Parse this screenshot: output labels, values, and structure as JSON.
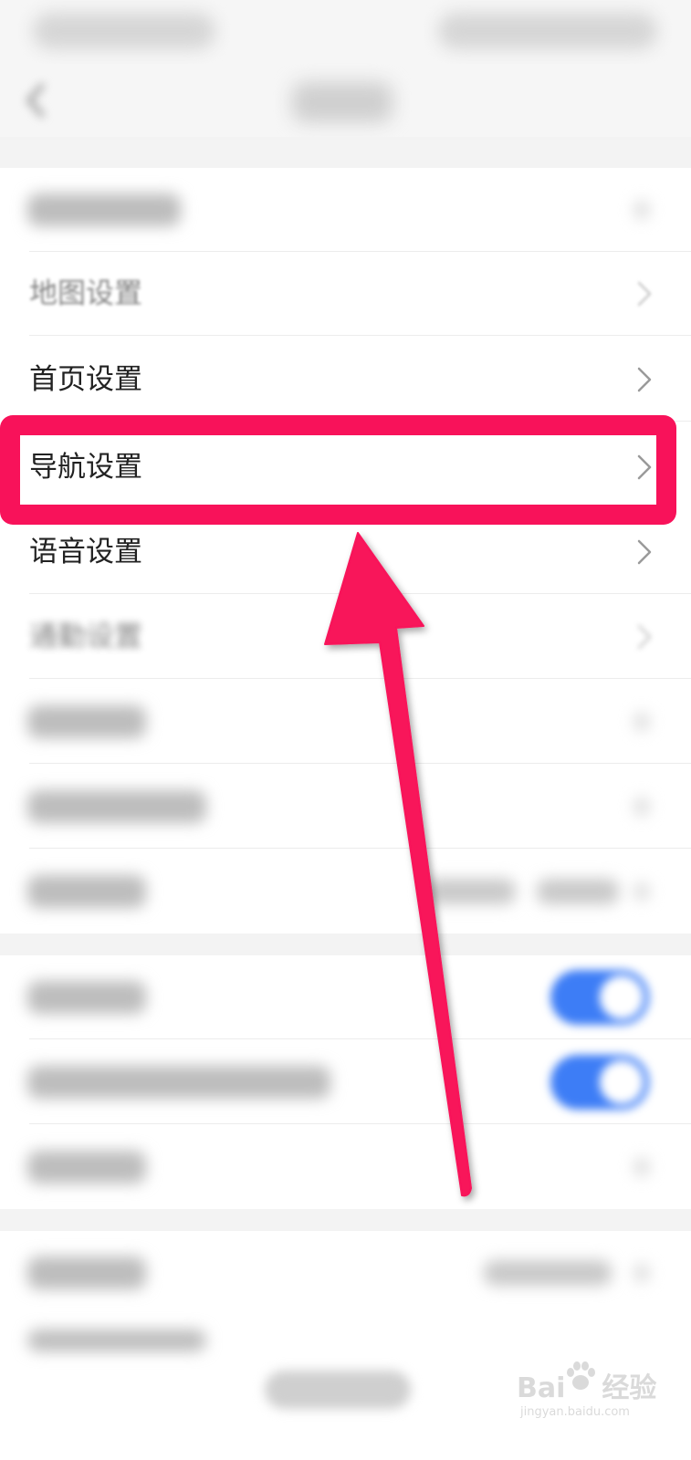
{
  "settings": {
    "rows": [
      {
        "label": "地图设置"
      },
      {
        "label": "首页设置"
      },
      {
        "label": "导航设置"
      },
      {
        "label": "语音设置"
      },
      {
        "label": "通勤设置"
      }
    ]
  },
  "watermark": {
    "brand": "Bai",
    "brand_suffix": "经验",
    "url": "jingyan.baidu.com"
  },
  "colors": {
    "highlight": "#f8125a",
    "toggle_on": "#3d7df6"
  },
  "icons": {
    "chevron": "chevron-right-icon",
    "back": "back-arrow-icon",
    "annotation_arrow": "annotation-arrow-icon"
  }
}
